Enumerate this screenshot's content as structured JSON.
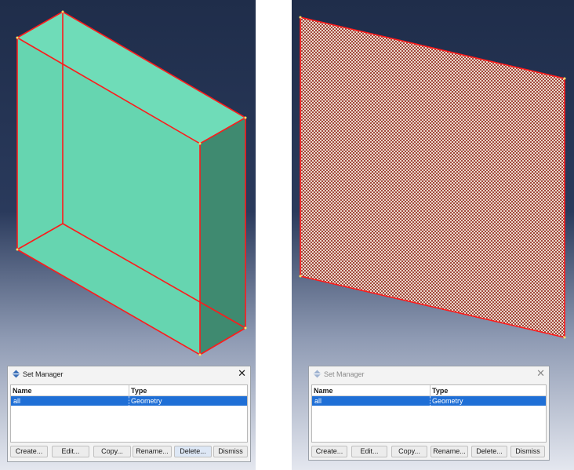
{
  "colors": {
    "viewport_top": "#1f2d4a",
    "viewport_bottom": "#e4e7ef",
    "edge_red": "#ff1a1a",
    "solid_front": "#66d5b0",
    "solid_top": "#6fdcb8",
    "solid_side": "#3f8a70",
    "mesh_fill": "#c89a88",
    "selected_row": "#1f6fd6"
  },
  "left_dialog": {
    "title": "Set Manager",
    "close_icon": "✕",
    "columns": [
      "Name",
      "Type"
    ],
    "rows": [
      {
        "name": "all",
        "type": "Geometry",
        "selected": true
      }
    ],
    "buttons": [
      "Create...",
      "Edit...",
      "Copy...",
      "Rename...",
      "Delete...",
      "Dismiss"
    ]
  },
  "right_dialog": {
    "title": "Set Manager",
    "close_icon": "✕",
    "columns": [
      "Name",
      "Type"
    ],
    "rows": [
      {
        "name": "all",
        "type": "Geometry",
        "selected": true
      }
    ],
    "buttons": [
      "Create...",
      "Edit...",
      "Copy...",
      "Rename...",
      "Delete...",
      "Dismiss"
    ]
  }
}
